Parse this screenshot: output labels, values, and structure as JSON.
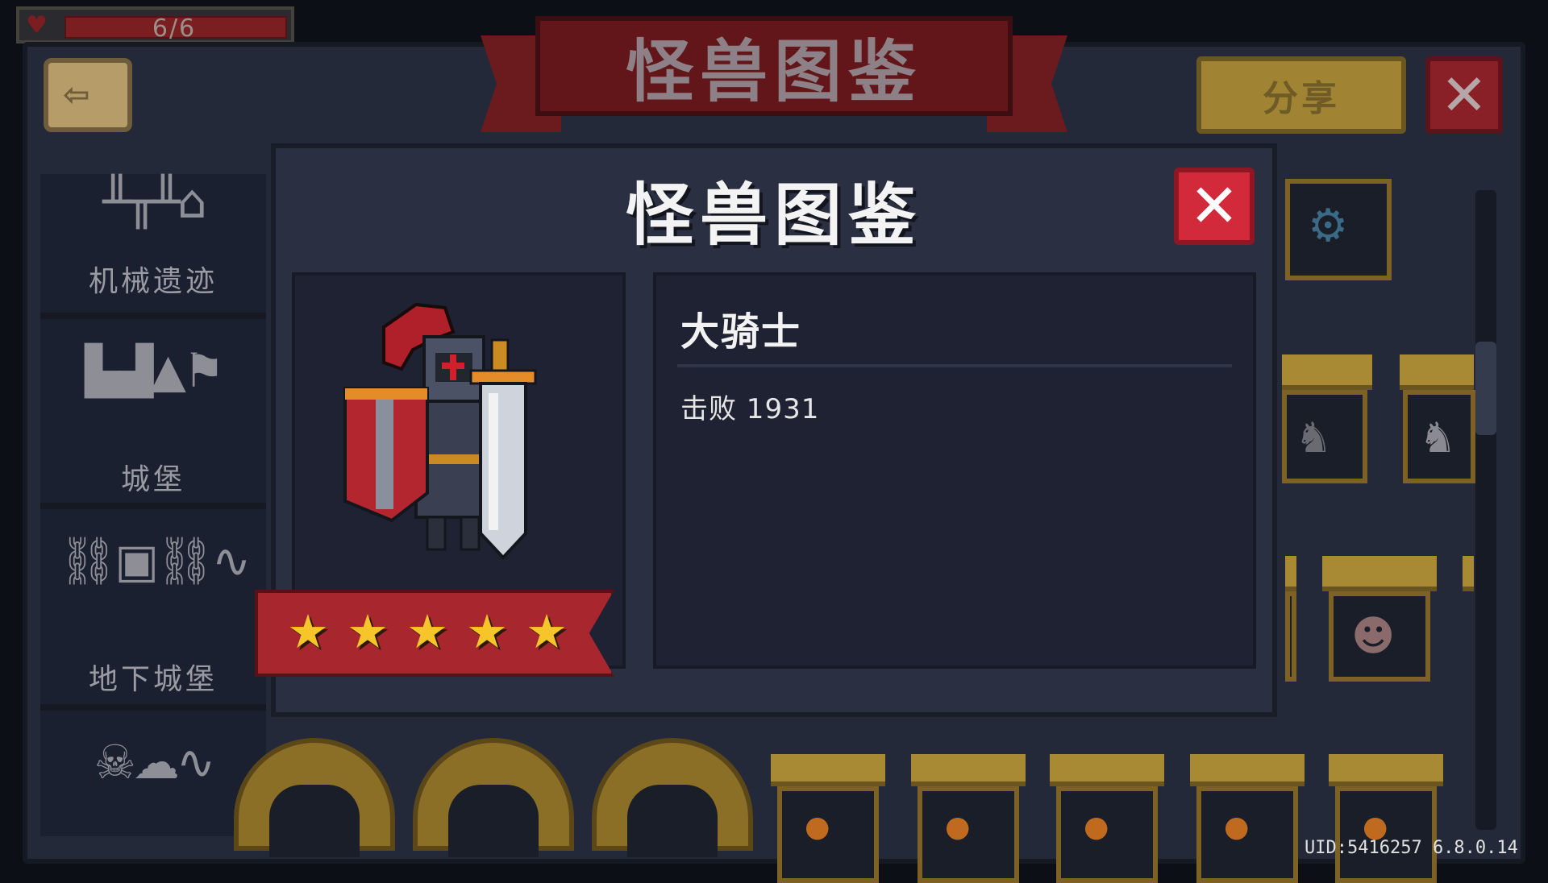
{
  "hud": {
    "hp_text": "6/6"
  },
  "header": {
    "title": "怪兽图鉴",
    "share_label": "分享",
    "close_label": "✕"
  },
  "categories": [
    {
      "label": "机械遗迹",
      "icon": "ruins-icon",
      "glyph": "╨╥╨⌂"
    },
    {
      "label": "城堡",
      "icon": "castle-icon",
      "glyph": "▙▟▲⚑"
    },
    {
      "label": "地下城堡",
      "icon": "dungeon-icon",
      "glyph": "⛓▣⛓∿"
    },
    {
      "label": "",
      "icon": "ghost-icon",
      "glyph": "☠☁∿"
    }
  ],
  "dialog": {
    "title": "怪兽图鉴",
    "close_label": "✕",
    "monster": {
      "name": "大骑士",
      "defeat_text": "击败 1931",
      "stars": 5,
      "star_glyph": "★"
    }
  },
  "footer": {
    "uid": "UID:5416257 6.8.0.14"
  },
  "colors": {
    "accent_red": "#d22a3a",
    "gold": "#a88a34",
    "panel": "#1e2232"
  }
}
